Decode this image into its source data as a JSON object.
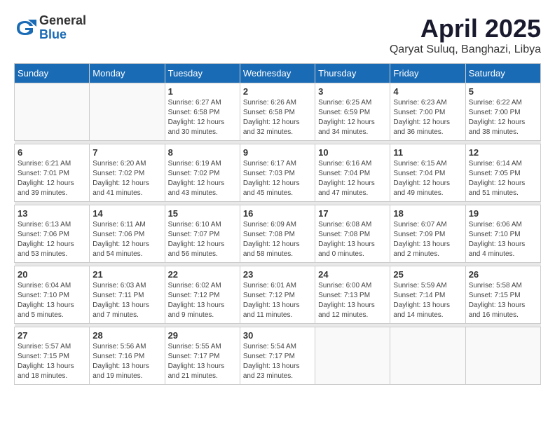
{
  "header": {
    "logo_general": "General",
    "logo_blue": "Blue",
    "month_title": "April 2025",
    "location": "Qaryat Suluq, Banghazi, Libya"
  },
  "weekdays": [
    "Sunday",
    "Monday",
    "Tuesday",
    "Wednesday",
    "Thursday",
    "Friday",
    "Saturday"
  ],
  "weeks": [
    [
      {
        "day": "",
        "sunrise": "",
        "sunset": "",
        "daylight": ""
      },
      {
        "day": "",
        "sunrise": "",
        "sunset": "",
        "daylight": ""
      },
      {
        "day": "1",
        "sunrise": "Sunrise: 6:27 AM",
        "sunset": "Sunset: 6:58 PM",
        "daylight": "Daylight: 12 hours and 30 minutes."
      },
      {
        "day": "2",
        "sunrise": "Sunrise: 6:26 AM",
        "sunset": "Sunset: 6:58 PM",
        "daylight": "Daylight: 12 hours and 32 minutes."
      },
      {
        "day": "3",
        "sunrise": "Sunrise: 6:25 AM",
        "sunset": "Sunset: 6:59 PM",
        "daylight": "Daylight: 12 hours and 34 minutes."
      },
      {
        "day": "4",
        "sunrise": "Sunrise: 6:23 AM",
        "sunset": "Sunset: 7:00 PM",
        "daylight": "Daylight: 12 hours and 36 minutes."
      },
      {
        "day": "5",
        "sunrise": "Sunrise: 6:22 AM",
        "sunset": "Sunset: 7:00 PM",
        "daylight": "Daylight: 12 hours and 38 minutes."
      }
    ],
    [
      {
        "day": "6",
        "sunrise": "Sunrise: 6:21 AM",
        "sunset": "Sunset: 7:01 PM",
        "daylight": "Daylight: 12 hours and 39 minutes."
      },
      {
        "day": "7",
        "sunrise": "Sunrise: 6:20 AM",
        "sunset": "Sunset: 7:02 PM",
        "daylight": "Daylight: 12 hours and 41 minutes."
      },
      {
        "day": "8",
        "sunrise": "Sunrise: 6:19 AM",
        "sunset": "Sunset: 7:02 PM",
        "daylight": "Daylight: 12 hours and 43 minutes."
      },
      {
        "day": "9",
        "sunrise": "Sunrise: 6:17 AM",
        "sunset": "Sunset: 7:03 PM",
        "daylight": "Daylight: 12 hours and 45 minutes."
      },
      {
        "day": "10",
        "sunrise": "Sunrise: 6:16 AM",
        "sunset": "Sunset: 7:04 PM",
        "daylight": "Daylight: 12 hours and 47 minutes."
      },
      {
        "day": "11",
        "sunrise": "Sunrise: 6:15 AM",
        "sunset": "Sunset: 7:04 PM",
        "daylight": "Daylight: 12 hours and 49 minutes."
      },
      {
        "day": "12",
        "sunrise": "Sunrise: 6:14 AM",
        "sunset": "Sunset: 7:05 PM",
        "daylight": "Daylight: 12 hours and 51 minutes."
      }
    ],
    [
      {
        "day": "13",
        "sunrise": "Sunrise: 6:13 AM",
        "sunset": "Sunset: 7:06 PM",
        "daylight": "Daylight: 12 hours and 53 minutes."
      },
      {
        "day": "14",
        "sunrise": "Sunrise: 6:11 AM",
        "sunset": "Sunset: 7:06 PM",
        "daylight": "Daylight: 12 hours and 54 minutes."
      },
      {
        "day": "15",
        "sunrise": "Sunrise: 6:10 AM",
        "sunset": "Sunset: 7:07 PM",
        "daylight": "Daylight: 12 hours and 56 minutes."
      },
      {
        "day": "16",
        "sunrise": "Sunrise: 6:09 AM",
        "sunset": "Sunset: 7:08 PM",
        "daylight": "Daylight: 12 hours and 58 minutes."
      },
      {
        "day": "17",
        "sunrise": "Sunrise: 6:08 AM",
        "sunset": "Sunset: 7:08 PM",
        "daylight": "Daylight: 13 hours and 0 minutes."
      },
      {
        "day": "18",
        "sunrise": "Sunrise: 6:07 AM",
        "sunset": "Sunset: 7:09 PM",
        "daylight": "Daylight: 13 hours and 2 minutes."
      },
      {
        "day": "19",
        "sunrise": "Sunrise: 6:06 AM",
        "sunset": "Sunset: 7:10 PM",
        "daylight": "Daylight: 13 hours and 4 minutes."
      }
    ],
    [
      {
        "day": "20",
        "sunrise": "Sunrise: 6:04 AM",
        "sunset": "Sunset: 7:10 PM",
        "daylight": "Daylight: 13 hours and 5 minutes."
      },
      {
        "day": "21",
        "sunrise": "Sunrise: 6:03 AM",
        "sunset": "Sunset: 7:11 PM",
        "daylight": "Daylight: 13 hours and 7 minutes."
      },
      {
        "day": "22",
        "sunrise": "Sunrise: 6:02 AM",
        "sunset": "Sunset: 7:12 PM",
        "daylight": "Daylight: 13 hours and 9 minutes."
      },
      {
        "day": "23",
        "sunrise": "Sunrise: 6:01 AM",
        "sunset": "Sunset: 7:12 PM",
        "daylight": "Daylight: 13 hours and 11 minutes."
      },
      {
        "day": "24",
        "sunrise": "Sunrise: 6:00 AM",
        "sunset": "Sunset: 7:13 PM",
        "daylight": "Daylight: 13 hours and 12 minutes."
      },
      {
        "day": "25",
        "sunrise": "Sunrise: 5:59 AM",
        "sunset": "Sunset: 7:14 PM",
        "daylight": "Daylight: 13 hours and 14 minutes."
      },
      {
        "day": "26",
        "sunrise": "Sunrise: 5:58 AM",
        "sunset": "Sunset: 7:15 PM",
        "daylight": "Daylight: 13 hours and 16 minutes."
      }
    ],
    [
      {
        "day": "27",
        "sunrise": "Sunrise: 5:57 AM",
        "sunset": "Sunset: 7:15 PM",
        "daylight": "Daylight: 13 hours and 18 minutes."
      },
      {
        "day": "28",
        "sunrise": "Sunrise: 5:56 AM",
        "sunset": "Sunset: 7:16 PM",
        "daylight": "Daylight: 13 hours and 19 minutes."
      },
      {
        "day": "29",
        "sunrise": "Sunrise: 5:55 AM",
        "sunset": "Sunset: 7:17 PM",
        "daylight": "Daylight: 13 hours and 21 minutes."
      },
      {
        "day": "30",
        "sunrise": "Sunrise: 5:54 AM",
        "sunset": "Sunset: 7:17 PM",
        "daylight": "Daylight: 13 hours and 23 minutes."
      },
      {
        "day": "",
        "sunrise": "",
        "sunset": "",
        "daylight": ""
      },
      {
        "day": "",
        "sunrise": "",
        "sunset": "",
        "daylight": ""
      },
      {
        "day": "",
        "sunrise": "",
        "sunset": "",
        "daylight": ""
      }
    ]
  ]
}
